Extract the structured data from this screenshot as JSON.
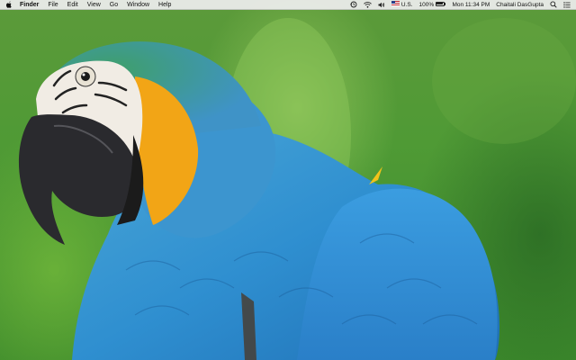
{
  "menubar": {
    "apple_icon": "apple-icon",
    "app_name": "Finder",
    "menus": [
      "File",
      "Edit",
      "View",
      "Go",
      "Window",
      "Help"
    ],
    "status": {
      "time_machine_icon": "time-machine-icon",
      "wifi_icon": "wifi-icon",
      "volume_icon": "volume-icon",
      "input_source_flag": "us-flag-icon",
      "input_source_label": "U.S.",
      "battery_percent_label": "100%",
      "battery_level": 1.0,
      "datetime": "Mon 11:34 PM",
      "user_name": "Chaitali DasGupta",
      "spotlight_icon": "search-icon",
      "notification_icon": "list-icon"
    }
  },
  "desktop": {
    "wallpaper": "blue-and-yellow-macaw"
  }
}
